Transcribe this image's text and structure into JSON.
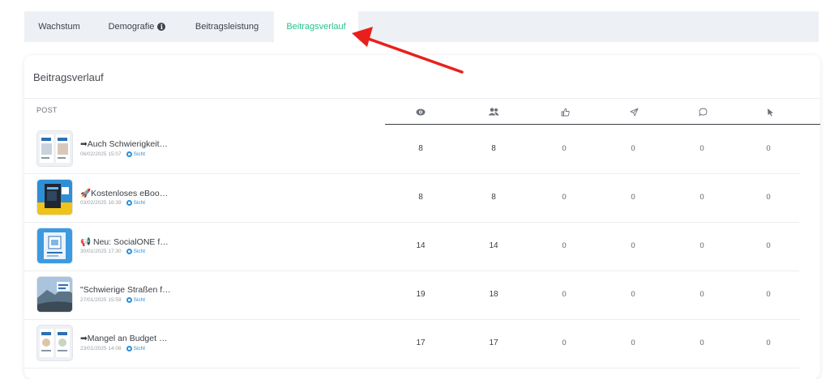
{
  "tabs": [
    {
      "label": "Wachstum",
      "active": false
    },
    {
      "label": "Demografie",
      "active": false,
      "info_icon": "i"
    },
    {
      "label": "Beitragsleistung",
      "active": false
    },
    {
      "label": "Beitragsverlauf",
      "active": true
    }
  ],
  "card": {
    "title": "Beitragsverlauf",
    "columns": {
      "post": "POST",
      "icons": [
        "eye-icon",
        "users-icon",
        "thumbs-up-icon",
        "send-icon",
        "comment-icon",
        "cursor-icon"
      ]
    }
  },
  "rows": [
    {
      "title": "➡Auch Schwierigkeit…",
      "date": "06/02/2025 15:07",
      "view_label": "Sicht",
      "values": [
        "8",
        "8",
        "0",
        "0",
        "0",
        "0"
      ]
    },
    {
      "title": "🚀Kostenloses eBoo…",
      "date": "03/02/2025 16:39",
      "view_label": "Sicht",
      "values": [
        "8",
        "8",
        "0",
        "0",
        "0",
        "0"
      ]
    },
    {
      "title": "📢 Neu: SocialONE f…",
      "date": "30/01/2025 17:30",
      "view_label": "Sicht",
      "values": [
        "14",
        "14",
        "0",
        "0",
        "0",
        "0"
      ]
    },
    {
      "title": "\"Schwierige Straßen f…",
      "date": "27/01/2025 15:59",
      "view_label": "Sicht",
      "values": [
        "19",
        "18",
        "0",
        "0",
        "0",
        "0"
      ]
    },
    {
      "title": "➡Mangel an Budget …",
      "date": "23/01/2025 14:08",
      "view_label": "Sicht",
      "values": [
        "17",
        "17",
        "0",
        "0",
        "0",
        "0"
      ]
    }
  ],
  "colors": {
    "accent": "#27c28f",
    "link": "#2a8fd9",
    "annotation_arrow": "#e8201b"
  }
}
